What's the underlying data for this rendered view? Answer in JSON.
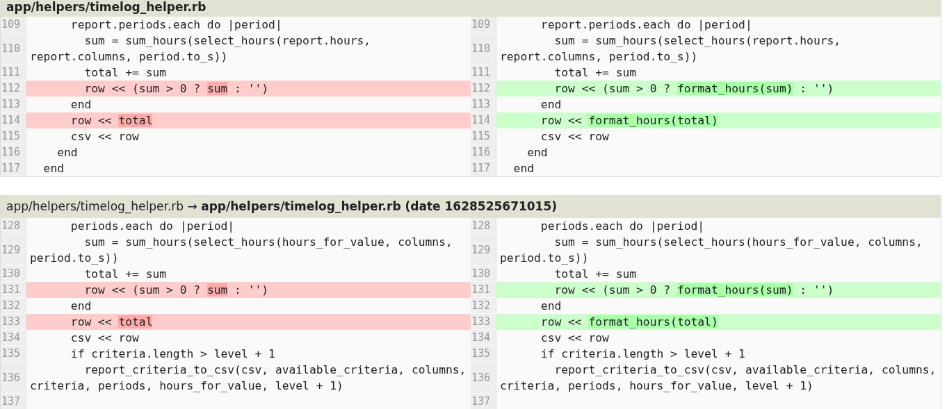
{
  "diffs": [
    {
      "header": {
        "kind": "single",
        "path": "app/helpers/timelog_helper.rb"
      },
      "rows": [
        {
          "left": {
            "number": "109",
            "kind": "context",
            "segments": [
              {
                "text": "      report.periods.each do |period|",
                "changed": false
              }
            ]
          },
          "right": {
            "number": "109",
            "kind": "context",
            "segments": [
              {
                "text": "      report.periods.each do |period|",
                "changed": false
              }
            ]
          }
        },
        {
          "left": {
            "number": "110",
            "kind": "context",
            "segments": [
              {
                "text": "        sum = sum_hours(select_hours(report.hours, report.columns, period.to_s))",
                "changed": false
              }
            ]
          },
          "right": {
            "number": "110",
            "kind": "context",
            "segments": [
              {
                "text": "        sum = sum_hours(select_hours(report.hours, report.columns, period.to_s))",
                "changed": false
              }
            ]
          }
        },
        {
          "left": {
            "number": "111",
            "kind": "context",
            "segments": [
              {
                "text": "        total += sum",
                "changed": false
              }
            ]
          },
          "right": {
            "number": "111",
            "kind": "context",
            "segments": [
              {
                "text": "        total += sum",
                "changed": false
              }
            ]
          }
        },
        {
          "left": {
            "number": "112",
            "kind": "deleted",
            "segments": [
              {
                "text": "        row << (sum > 0 ? ",
                "changed": false
              },
              {
                "text": "sum",
                "changed": true
              },
              {
                "text": " : '')",
                "changed": false
              }
            ]
          },
          "right": {
            "number": "112",
            "kind": "added",
            "segments": [
              {
                "text": "        row << (sum > 0 ? ",
                "changed": false
              },
              {
                "text": "format_hours(sum)",
                "changed": true
              },
              {
                "text": " : '')",
                "changed": false
              }
            ]
          }
        },
        {
          "left": {
            "number": "113",
            "kind": "context",
            "segments": [
              {
                "text": "      end",
                "changed": false
              }
            ]
          },
          "right": {
            "number": "113",
            "kind": "context",
            "segments": [
              {
                "text": "      end",
                "changed": false
              }
            ]
          }
        },
        {
          "left": {
            "number": "114",
            "kind": "deleted",
            "segments": [
              {
                "text": "      row << ",
                "changed": false
              },
              {
                "text": "total",
                "changed": true
              }
            ]
          },
          "right": {
            "number": "114",
            "kind": "added",
            "segments": [
              {
                "text": "      row << ",
                "changed": false
              },
              {
                "text": "format_hours(total)",
                "changed": true
              }
            ]
          }
        },
        {
          "left": {
            "number": "115",
            "kind": "context",
            "segments": [
              {
                "text": "      csv << row",
                "changed": false
              }
            ]
          },
          "right": {
            "number": "115",
            "kind": "context",
            "segments": [
              {
                "text": "      csv << row",
                "changed": false
              }
            ]
          }
        },
        {
          "left": {
            "number": "116",
            "kind": "context",
            "segments": [
              {
                "text": "    end",
                "changed": false
              }
            ]
          },
          "right": {
            "number": "116",
            "kind": "context",
            "segments": [
              {
                "text": "    end",
                "changed": false
              }
            ]
          }
        },
        {
          "left": {
            "number": "117",
            "kind": "context",
            "segments": [
              {
                "text": "  end",
                "changed": false
              }
            ]
          },
          "right": {
            "number": "117",
            "kind": "context",
            "segments": [
              {
                "text": "  end",
                "changed": false
              }
            ]
          }
        }
      ]
    },
    {
      "header": {
        "kind": "rename",
        "from_path": "app/helpers/timelog_helper.rb",
        "separator": "→",
        "to_path": "app/helpers/timelog_helper.rb (date 1628525671015)"
      },
      "rows": [
        {
          "left": {
            "number": "128",
            "kind": "context",
            "segments": [
              {
                "text": "      periods.each do |period|",
                "changed": false
              }
            ]
          },
          "right": {
            "number": "128",
            "kind": "context",
            "segments": [
              {
                "text": "      periods.each do |period|",
                "changed": false
              }
            ]
          }
        },
        {
          "left": {
            "number": "129",
            "kind": "context",
            "segments": [
              {
                "text": "        sum = sum_hours(select_hours(hours_for_value, columns, period.to_s))",
                "changed": false
              }
            ]
          },
          "right": {
            "number": "129",
            "kind": "context",
            "segments": [
              {
                "text": "        sum = sum_hours(select_hours(hours_for_value, columns, period.to_s))",
                "changed": false
              }
            ]
          }
        },
        {
          "left": {
            "number": "130",
            "kind": "context",
            "segments": [
              {
                "text": "        total += sum",
                "changed": false
              }
            ]
          },
          "right": {
            "number": "130",
            "kind": "context",
            "segments": [
              {
                "text": "        total += sum",
                "changed": false
              }
            ]
          }
        },
        {
          "left": {
            "number": "131",
            "kind": "deleted",
            "segments": [
              {
                "text": "        row << (sum > 0 ? ",
                "changed": false
              },
              {
                "text": "sum",
                "changed": true
              },
              {
                "text": " : '')",
                "changed": false
              }
            ]
          },
          "right": {
            "number": "131",
            "kind": "added",
            "segments": [
              {
                "text": "        row << (sum > 0 ? ",
                "changed": false
              },
              {
                "text": "format_hours(sum)",
                "changed": true
              },
              {
                "text": " : '')",
                "changed": false
              }
            ]
          }
        },
        {
          "left": {
            "number": "132",
            "kind": "context",
            "segments": [
              {
                "text": "      end",
                "changed": false
              }
            ]
          },
          "right": {
            "number": "132",
            "kind": "context",
            "segments": [
              {
                "text": "      end",
                "changed": false
              }
            ]
          }
        },
        {
          "left": {
            "number": "133",
            "kind": "deleted",
            "segments": [
              {
                "text": "      row << ",
                "changed": false
              },
              {
                "text": "total",
                "changed": true
              }
            ]
          },
          "right": {
            "number": "133",
            "kind": "added",
            "segments": [
              {
                "text": "      row << ",
                "changed": false
              },
              {
                "text": "format_hours(total)",
                "changed": true
              }
            ]
          }
        },
        {
          "left": {
            "number": "134",
            "kind": "context",
            "segments": [
              {
                "text": "      csv << row",
                "changed": false
              }
            ]
          },
          "right": {
            "number": "134",
            "kind": "context",
            "segments": [
              {
                "text": "      csv << row",
                "changed": false
              }
            ]
          }
        },
        {
          "left": {
            "number": "135",
            "kind": "context",
            "segments": [
              {
                "text": "      if criteria.length > level + 1",
                "changed": false
              }
            ]
          },
          "right": {
            "number": "135",
            "kind": "context",
            "segments": [
              {
                "text": "      if criteria.length > level + 1",
                "changed": false
              }
            ]
          }
        },
        {
          "left": {
            "number": "136",
            "kind": "context",
            "segments": [
              {
                "text": "        report_criteria_to_csv(csv, available_criteria, columns, criteria, periods, hours_for_value, level + 1)",
                "changed": false
              }
            ]
          },
          "right": {
            "number": "136",
            "kind": "context",
            "segments": [
              {
                "text": "        report_criteria_to_csv(csv, available_criteria, columns, criteria, periods, hours_for_value, level + 1)",
                "changed": false
              }
            ]
          }
        },
        {
          "left": {
            "number": "137",
            "kind": "context"
          },
          "right": {
            "number": "137",
            "kind": "context"
          }
        }
      ]
    }
  ]
}
